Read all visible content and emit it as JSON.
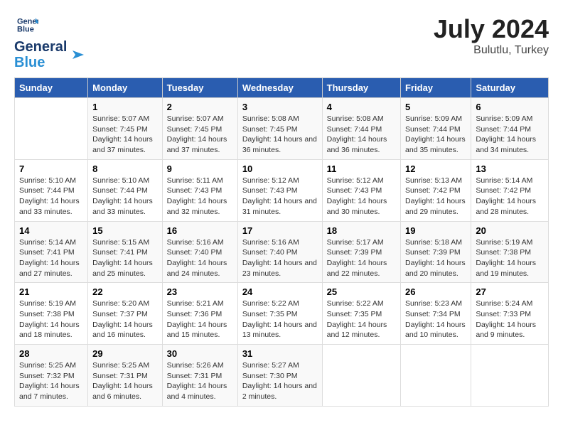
{
  "header": {
    "logo_line1": "General",
    "logo_line2": "Blue",
    "month_year": "July 2024",
    "location": "Bulutlu, Turkey"
  },
  "columns": [
    "Sunday",
    "Monday",
    "Tuesday",
    "Wednesday",
    "Thursday",
    "Friday",
    "Saturday"
  ],
  "weeks": [
    [
      {
        "day": "",
        "sunrise": "",
        "sunset": "",
        "daylight": ""
      },
      {
        "day": "1",
        "sunrise": "Sunrise: 5:07 AM",
        "sunset": "Sunset: 7:45 PM",
        "daylight": "Daylight: 14 hours and 37 minutes."
      },
      {
        "day": "2",
        "sunrise": "Sunrise: 5:07 AM",
        "sunset": "Sunset: 7:45 PM",
        "daylight": "Daylight: 14 hours and 37 minutes."
      },
      {
        "day": "3",
        "sunrise": "Sunrise: 5:08 AM",
        "sunset": "Sunset: 7:45 PM",
        "daylight": "Daylight: 14 hours and 36 minutes."
      },
      {
        "day": "4",
        "sunrise": "Sunrise: 5:08 AM",
        "sunset": "Sunset: 7:44 PM",
        "daylight": "Daylight: 14 hours and 36 minutes."
      },
      {
        "day": "5",
        "sunrise": "Sunrise: 5:09 AM",
        "sunset": "Sunset: 7:44 PM",
        "daylight": "Daylight: 14 hours and 35 minutes."
      },
      {
        "day": "6",
        "sunrise": "Sunrise: 5:09 AM",
        "sunset": "Sunset: 7:44 PM",
        "daylight": "Daylight: 14 hours and 34 minutes."
      }
    ],
    [
      {
        "day": "7",
        "sunrise": "Sunrise: 5:10 AM",
        "sunset": "Sunset: 7:44 PM",
        "daylight": "Daylight: 14 hours and 33 minutes."
      },
      {
        "day": "8",
        "sunrise": "Sunrise: 5:10 AM",
        "sunset": "Sunset: 7:44 PM",
        "daylight": "Daylight: 14 hours and 33 minutes."
      },
      {
        "day": "9",
        "sunrise": "Sunrise: 5:11 AM",
        "sunset": "Sunset: 7:43 PM",
        "daylight": "Daylight: 14 hours and 32 minutes."
      },
      {
        "day": "10",
        "sunrise": "Sunrise: 5:12 AM",
        "sunset": "Sunset: 7:43 PM",
        "daylight": "Daylight: 14 hours and 31 minutes."
      },
      {
        "day": "11",
        "sunrise": "Sunrise: 5:12 AM",
        "sunset": "Sunset: 7:43 PM",
        "daylight": "Daylight: 14 hours and 30 minutes."
      },
      {
        "day": "12",
        "sunrise": "Sunrise: 5:13 AM",
        "sunset": "Sunset: 7:42 PM",
        "daylight": "Daylight: 14 hours and 29 minutes."
      },
      {
        "day": "13",
        "sunrise": "Sunrise: 5:14 AM",
        "sunset": "Sunset: 7:42 PM",
        "daylight": "Daylight: 14 hours and 28 minutes."
      }
    ],
    [
      {
        "day": "14",
        "sunrise": "Sunrise: 5:14 AM",
        "sunset": "Sunset: 7:41 PM",
        "daylight": "Daylight: 14 hours and 27 minutes."
      },
      {
        "day": "15",
        "sunrise": "Sunrise: 5:15 AM",
        "sunset": "Sunset: 7:41 PM",
        "daylight": "Daylight: 14 hours and 25 minutes."
      },
      {
        "day": "16",
        "sunrise": "Sunrise: 5:16 AM",
        "sunset": "Sunset: 7:40 PM",
        "daylight": "Daylight: 14 hours and 24 minutes."
      },
      {
        "day": "17",
        "sunrise": "Sunrise: 5:16 AM",
        "sunset": "Sunset: 7:40 PM",
        "daylight": "Daylight: 14 hours and 23 minutes."
      },
      {
        "day": "18",
        "sunrise": "Sunrise: 5:17 AM",
        "sunset": "Sunset: 7:39 PM",
        "daylight": "Daylight: 14 hours and 22 minutes."
      },
      {
        "day": "19",
        "sunrise": "Sunrise: 5:18 AM",
        "sunset": "Sunset: 7:39 PM",
        "daylight": "Daylight: 14 hours and 20 minutes."
      },
      {
        "day": "20",
        "sunrise": "Sunrise: 5:19 AM",
        "sunset": "Sunset: 7:38 PM",
        "daylight": "Daylight: 14 hours and 19 minutes."
      }
    ],
    [
      {
        "day": "21",
        "sunrise": "Sunrise: 5:19 AM",
        "sunset": "Sunset: 7:38 PM",
        "daylight": "Daylight: 14 hours and 18 minutes."
      },
      {
        "day": "22",
        "sunrise": "Sunrise: 5:20 AM",
        "sunset": "Sunset: 7:37 PM",
        "daylight": "Daylight: 14 hours and 16 minutes."
      },
      {
        "day": "23",
        "sunrise": "Sunrise: 5:21 AM",
        "sunset": "Sunset: 7:36 PM",
        "daylight": "Daylight: 14 hours and 15 minutes."
      },
      {
        "day": "24",
        "sunrise": "Sunrise: 5:22 AM",
        "sunset": "Sunset: 7:35 PM",
        "daylight": "Daylight: 14 hours and 13 minutes."
      },
      {
        "day": "25",
        "sunrise": "Sunrise: 5:22 AM",
        "sunset": "Sunset: 7:35 PM",
        "daylight": "Daylight: 14 hours and 12 minutes."
      },
      {
        "day": "26",
        "sunrise": "Sunrise: 5:23 AM",
        "sunset": "Sunset: 7:34 PM",
        "daylight": "Daylight: 14 hours and 10 minutes."
      },
      {
        "day": "27",
        "sunrise": "Sunrise: 5:24 AM",
        "sunset": "Sunset: 7:33 PM",
        "daylight": "Daylight: 14 hours and 9 minutes."
      }
    ],
    [
      {
        "day": "28",
        "sunrise": "Sunrise: 5:25 AM",
        "sunset": "Sunset: 7:32 PM",
        "daylight": "Daylight: 14 hours and 7 minutes."
      },
      {
        "day": "29",
        "sunrise": "Sunrise: 5:25 AM",
        "sunset": "Sunset: 7:31 PM",
        "daylight": "Daylight: 14 hours and 6 minutes."
      },
      {
        "day": "30",
        "sunrise": "Sunrise: 5:26 AM",
        "sunset": "Sunset: 7:31 PM",
        "daylight": "Daylight: 14 hours and 4 minutes."
      },
      {
        "day": "31",
        "sunrise": "Sunrise: 5:27 AM",
        "sunset": "Sunset: 7:30 PM",
        "daylight": "Daylight: 14 hours and 2 minutes."
      },
      {
        "day": "",
        "sunrise": "",
        "sunset": "",
        "daylight": ""
      },
      {
        "day": "",
        "sunrise": "",
        "sunset": "",
        "daylight": ""
      },
      {
        "day": "",
        "sunrise": "",
        "sunset": "",
        "daylight": ""
      }
    ]
  ]
}
